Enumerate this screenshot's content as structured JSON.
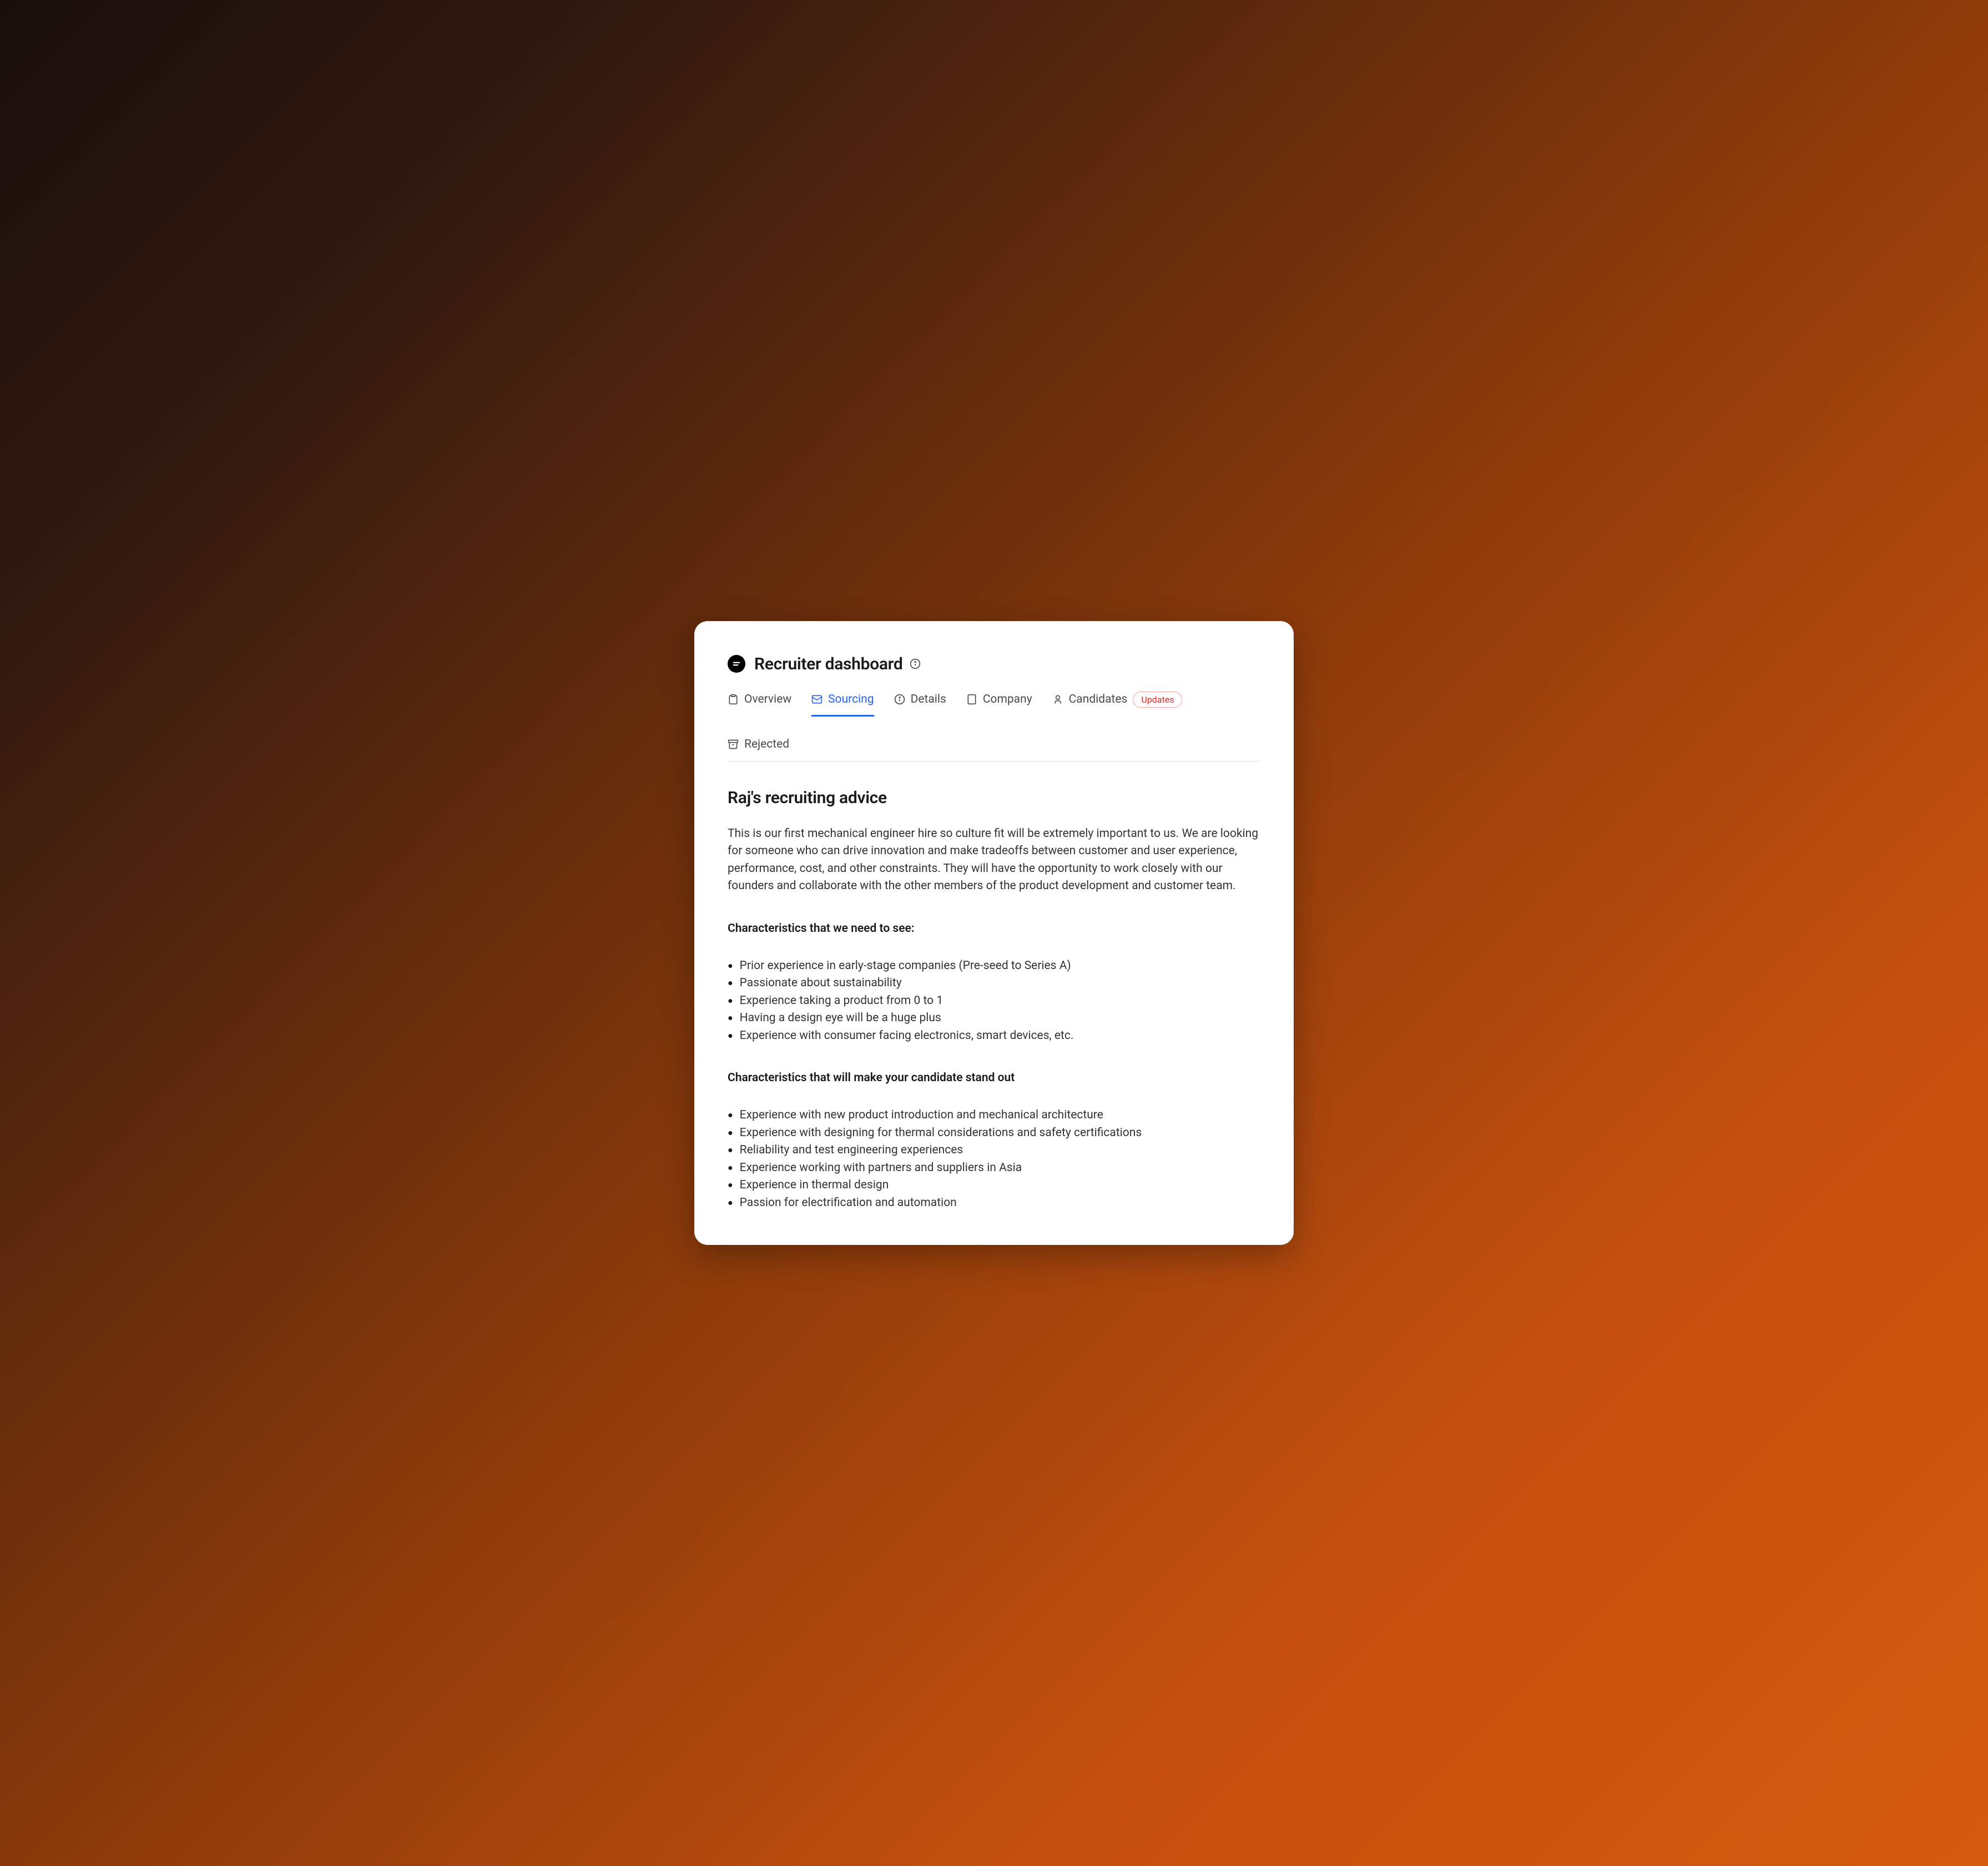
{
  "header": {
    "title": "Recruiter dashboard"
  },
  "tabs": [
    {
      "id": "overview",
      "label": "Overview",
      "icon": "clipboard",
      "active": false
    },
    {
      "id": "sourcing",
      "label": "Sourcing",
      "icon": "mail",
      "active": true
    },
    {
      "id": "details",
      "label": "Details",
      "icon": "info",
      "active": false
    },
    {
      "id": "company",
      "label": "Company",
      "icon": "building",
      "active": false
    },
    {
      "id": "candidates",
      "label": "Candidates",
      "icon": "user",
      "active": false,
      "badge": "Updates"
    },
    {
      "id": "rejected",
      "label": "Rejected",
      "icon": "archive",
      "active": false,
      "rightAligned": true
    }
  ],
  "content": {
    "heading": "Raj's recruiting advice",
    "intro": "This is our first mechanical engineer hire so culture fit will be extremely important to us. We are looking for someone who can drive innovation and make tradeoffs between customer and user experience, performance, cost, and other constraints. They will have the opportunity to work closely with our founders and collaborate with the other members of the product development and customer team.",
    "sections": [
      {
        "heading": "Characteristics that we need to see:",
        "items": [
          "Prior experience in early-stage companies (Pre-seed to Series A)",
          "Passionate about sustainability",
          "Experience taking a product from 0 to 1",
          "Having a design eye will be a huge plus",
          "Experience with consumer facing electronics, smart devices, etc."
        ]
      },
      {
        "heading": "Characteristics that will make your candidate stand out",
        "items": [
          "Experience with new product introduction and mechanical architecture",
          "Experience with designing for thermal considerations and safety certifications",
          "Reliability and test engineering experiences",
          "Experience working with partners and suppliers in Asia",
          "Experience in thermal design",
          "Passion for electrification and automation"
        ]
      }
    ]
  }
}
